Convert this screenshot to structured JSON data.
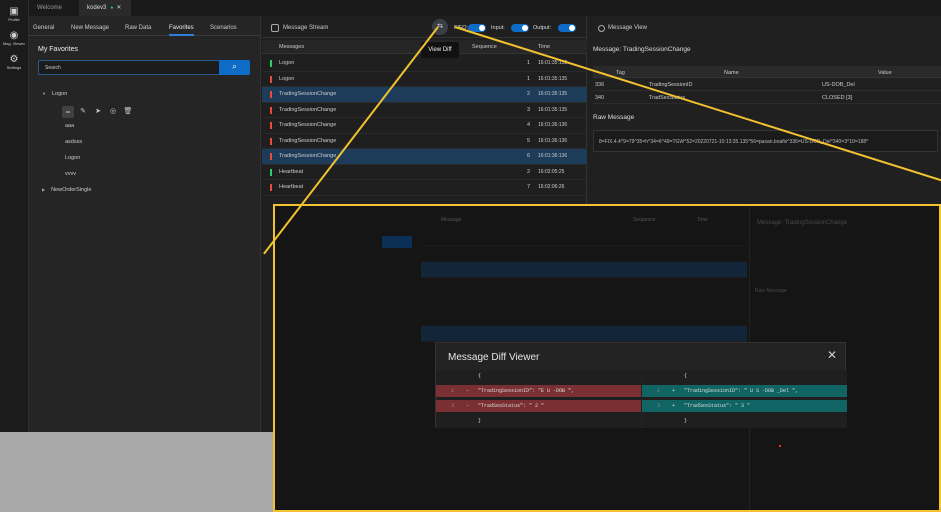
{
  "leftbar": {
    "items": [
      {
        "label": "Profile",
        "icon": "profile-icon"
      },
      {
        "label": "Msg. Viewer",
        "icon": "eye-icon"
      },
      {
        "label": "Settings",
        "icon": "gear-icon"
      }
    ]
  },
  "doc_tabs": [
    {
      "label": "Welcome"
    },
    {
      "label": "kodev3"
    }
  ],
  "side": {
    "tabs": [
      "General",
      "New Message",
      "Raw Data",
      "Favorites",
      "Scenarios"
    ],
    "title": "My Favorites",
    "search_placeholder": "Search",
    "tree": {
      "logon": "Logon",
      "children": [
        "aaa",
        "asdsss",
        "Logon",
        "vvvv"
      ],
      "selected_chip": "aa",
      "neworder": "NewOrderSingle"
    }
  },
  "stream": {
    "title": "Message Stream",
    "toggles": [
      "FIFO:",
      "Input:",
      "Output:"
    ],
    "tooltip": "View Diff",
    "cols": [
      "Messages",
      "Sequence",
      "Time"
    ],
    "rows": [
      {
        "name": "Logon",
        "seq": "1",
        "time": "16:01:35:132",
        "color": "#2ecc71",
        "sel": false
      },
      {
        "name": "Logon",
        "seq": "1",
        "time": "16:01:35:135",
        "color": "#e74c3c",
        "sel": false
      },
      {
        "name": "TradingSessionChange",
        "seq": "2",
        "time": "16:01:35:135",
        "color": "#e74c3c",
        "sel": true
      },
      {
        "name": "TradingSessionChange",
        "seq": "3",
        "time": "16:01:35:135",
        "color": "#e74c3c",
        "sel": false
      },
      {
        "name": "TradingSessionChange",
        "seq": "4",
        "time": "16:01:36:136",
        "color": "#e74c3c",
        "sel": false
      },
      {
        "name": "TradingSessionChange",
        "seq": "5",
        "time": "16:01:36:136",
        "color": "#e74c3c",
        "sel": false
      },
      {
        "name": "TradingSessionChange",
        "seq": "6",
        "time": "16:01:36:136",
        "color": "#e74c3c",
        "sel": true
      },
      {
        "name": "Heartbeat",
        "seq": "2",
        "time": "16:02:05:25",
        "color": "#2ecc71",
        "sel": false
      },
      {
        "name": "Heartbeat",
        "seq": "7",
        "time": "16:02:06:26",
        "color": "#e74c3c",
        "sel": false
      }
    ]
  },
  "view": {
    "title": "Message View",
    "message": "Message: TradingSessionChange",
    "cols": [
      "Tag",
      "Name",
      "Value"
    ],
    "rows": [
      {
        "tag": "336",
        "name": "TradingSessionID",
        "value": "US-DOB_Del"
      },
      {
        "tag": "340",
        "name": "TradSesStatus",
        "value": "CLOSED [3]"
      }
    ],
    "raw_title": "Raw Message",
    "raw": "8=FIX.4.4^9=79^35=h^34=6^49=TGW^52=20220721-10:13:35.135^56=pasan.boafix^336=US-DOB_Del^340=3^10=188^"
  },
  "zoom": {
    "cols": [
      "Message",
      "Sequence",
      "Time"
    ],
    "view_msg": "Message: TradingSessionChange",
    "raw_title": "Raw Message"
  },
  "diff": {
    "title": "Message Diff Viewer",
    "left": [
      {
        "n": "",
        "s": "",
        "t": "{"
      },
      {
        "n": "2",
        "s": "-",
        "t": "\"TradingSessionID\": \"E U -DOB \","
      },
      {
        "n": "3",
        "s": "-",
        "t": "\"TradSesStatus\": \" 2 \""
      },
      {
        "n": "",
        "s": "",
        "t": "}"
      }
    ],
    "right": [
      {
        "n": "",
        "s": "",
        "t": "{"
      },
      {
        "n": "2",
        "s": "+",
        "t": "\"TradingSessionID\": \" U S -DOB _Del \","
      },
      {
        "n": "3",
        "s": "+",
        "t": "\"TradSesStatus\": \" 3 \""
      },
      {
        "n": "",
        "s": "",
        "t": "}"
      }
    ]
  }
}
